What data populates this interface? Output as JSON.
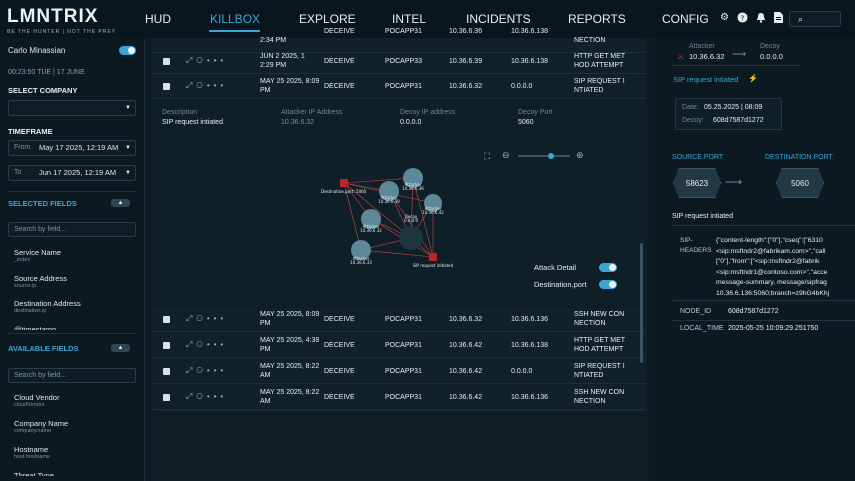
{
  "header": {
    "logo": "LMNTRIX",
    "tagline": "BE THE HUNTER  |  NOT THE PREY",
    "nav": [
      "HUD",
      "KILLBOX",
      "EXPLORE",
      "INTEL",
      "INCIDENTS",
      "REPORTS",
      "CONFIG"
    ],
    "active_nav": "KILLBOX"
  },
  "sidebar": {
    "user": "Carlo Minassian",
    "time": "00:23:50  TUE  |  17 JUNE",
    "select_company_label": "SELECT COMPANY",
    "timeframe_label": "TIMEFRAME",
    "from_label": "From",
    "from_value": "May 17 2025, 12:19 AM",
    "to_label": "To",
    "to_value": "Jun 17 2025, 12:19 AM",
    "selected_fields_label": "SELECTED FIELDS",
    "available_fields_label": "AVAILABLE FIELDS",
    "search_placeholder": "Search by field...",
    "selected_fields": [
      {
        "name": "Service Name",
        "sub": "_index"
      },
      {
        "name": "Source Address",
        "sub": "source.ip"
      },
      {
        "name": "Destination Address",
        "sub": "destination.ip"
      },
      {
        "name": "@timestamp",
        "sub": ""
      }
    ],
    "available_fields": [
      {
        "name": "Cloud Vendor",
        "sub": "cloudVendor"
      },
      {
        "name": "Company Name",
        "sub": "company.name"
      },
      {
        "name": "Hostname",
        "sub": "host.hostname"
      },
      {
        "name": "Threat Type",
        "sub": ""
      }
    ]
  },
  "table": {
    "rows_top": [
      {
        "date": "2:34 PM",
        "action": "DECEIVE",
        "host": "POCAPP31",
        "src": "10.36.6.36",
        "dst": "10.36.6.138",
        "event": "NECTION"
      },
      {
        "date": "JUN 2 2025, 1 2:29 PM",
        "action": "DECEIVE",
        "host": "POCAPP33",
        "src": "10.36.6.39",
        "dst": "10.36.6.138",
        "event": "HTTP GET MET HOD ATTEMPT"
      },
      {
        "date": "MAY 25 2025, 8:09 PM",
        "action": "DECEIVE",
        "host": "POCAPP31",
        "src": "10.36.6.32",
        "dst": "0.0.0.0",
        "event": "SIP REQUEST I NTIATED"
      }
    ],
    "rows_bottom": [
      {
        "date": "MAY 25 2025, 8:09 PM",
        "action": "DECEIVE",
        "host": "POCAPP31",
        "src": "10.36.6.32",
        "dst": "10.36.6.136",
        "event": "SSH NEW CON NECTION"
      },
      {
        "date": "MAY 25 2025, 4:38 PM",
        "action": "DECEIVE",
        "host": "POCAPP31",
        "src": "10.36.6.42",
        "dst": "10.36.6.138",
        "event": "HTTP GET MET HOD ATTEMPT"
      },
      {
        "date": "MAY 25 2025, 8:22 AM",
        "action": "DECEIVE",
        "host": "POCAPP31",
        "src": "10.36.6.42",
        "dst": "0.0.0.0",
        "event": "SIP REQUEST I NTIATED"
      },
      {
        "date": "MAY 25 2025, 8:22 AM",
        "action": "DECEIVE",
        "host": "POCAPP31",
        "src": "10.36.6.42",
        "dst": "10.36.6.136",
        "event": "SSH NEW CON NECTION"
      }
    ]
  },
  "detail": {
    "description_label": "Description",
    "description_value": "SIP request intiated",
    "attacker_ip_label": "Attacker IP Address",
    "attacker_ip_value": "10.36.6.32",
    "decoy_ip_label": "Decoy IP address",
    "decoy_ip_value": "0.0.0.0",
    "decoy_port_label": "Decoy Port",
    "decoy_port_value": "5060",
    "legend_attack_detail": "Attack Detail",
    "legend_destination_port": "Destination.port",
    "graph_labels": {
      "dest_port": "Destination.port: 5060",
      "attacker1": "Attacker",
      "attacker1_ip": "10.36.6.36",
      "attacker2": "Attacker",
      "attacker2_ip": "10.36.6.39",
      "attacker3": "Attacker",
      "attacker3_ip": "10.36.6.42",
      "decoy": "Decoy",
      "decoy_ip": "0.0.0.0",
      "attacker4": "Attacker",
      "attacker4_ip": "10.36.6.32",
      "attacker5": "Attacker",
      "attacker5_ip": "10.36.6.33",
      "sip": "SIP request initiated"
    }
  },
  "right_panel": {
    "attacker_label": "Attacker",
    "attacker_ip": "10.36.6.32",
    "decoy_label": "Decoy",
    "decoy_ip": "0.0.0.0",
    "event_title": "SIP request intiated",
    "date_label": "Date:",
    "date_value": "05.25.2025  |  08:09",
    "decoy_id_label": "Decoy:",
    "decoy_id_value": "608d7587d1272",
    "source_port_label": "SOURCE.PORT",
    "destination_port_label": "DESTINATION.PORT",
    "source_port_value": "58623",
    "destination_port_value": "5060",
    "event_sub": "SIP request intiated",
    "sip_headers_label": "SIP-\nHEADERS",
    "sip_headers_lines": [
      "{\"content-length\":[\"0\"],\"cseq\":[\"6310",
      "<sip:msftndr2@fabrikam.com>\",\"call",
      "[\"0\"],\"from\":[\"<sip:msftndr2@fabrik",
      "<sip:msftndr1@contoso.com>\",\"acce",
      "message-summary, message/sipfrag",
      "10.36.6.136:5060;branch=z9hG4bKhj"
    ],
    "node_id_label": "NODE_ID",
    "node_id_value": "608d7587d1272",
    "local_time_label": "LOCAL_TIME",
    "local_time_value": "2025-05-25 10:09:29.251750"
  }
}
